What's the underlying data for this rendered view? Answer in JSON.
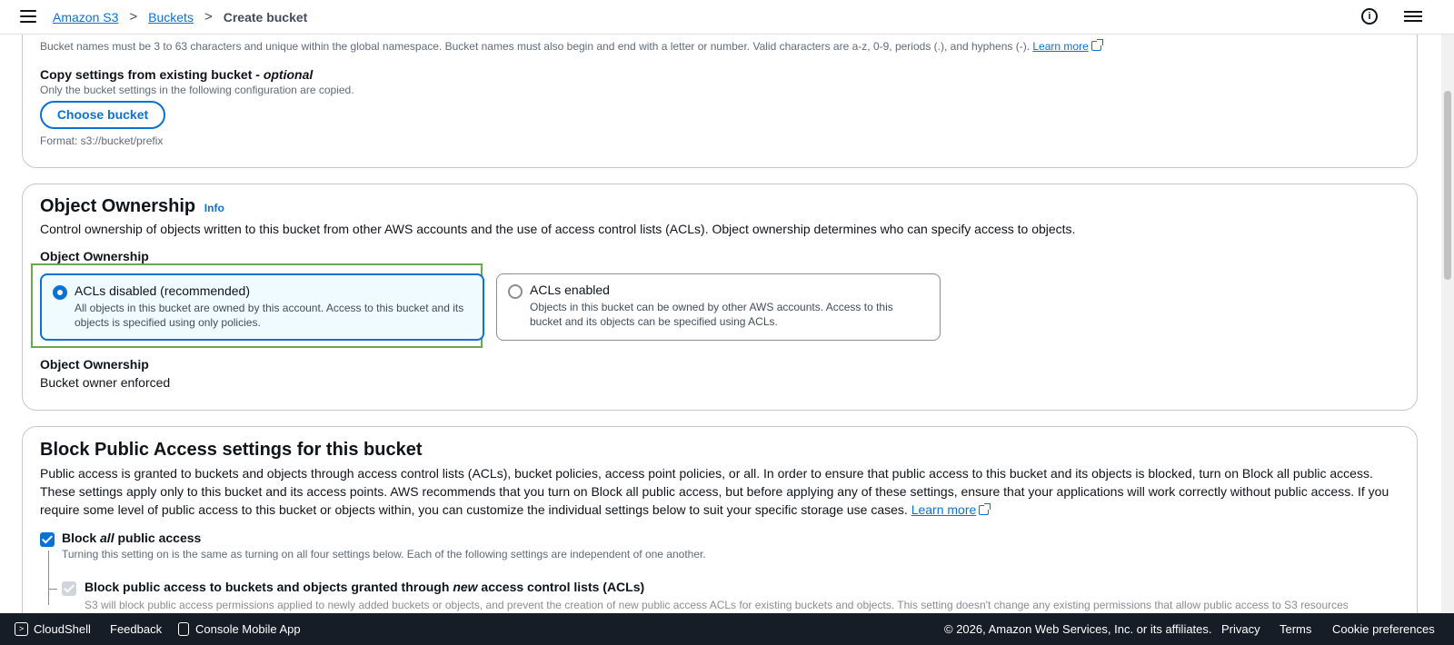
{
  "breadcrumb": {
    "items": [
      "Amazon S3",
      "Buckets"
    ],
    "current": "Create bucket",
    "separator": ">"
  },
  "topbar": {
    "info_icon": "info-icon",
    "tools_icon": "settings-panel-icon"
  },
  "bucket_name": {
    "help": "Bucket names must be 3 to 63 characters and unique within the global namespace. Bucket names must also begin and end with a letter or number. Valid characters are a-z, 0-9, periods (.), and hyphens (-).",
    "learn_more": "Learn more"
  },
  "copy_settings": {
    "title": "Copy settings from existing bucket - ",
    "title_optional": "optional",
    "description": "Only the bucket settings in the following configuration are copied.",
    "button": "Choose bucket",
    "format": "Format: s3://bucket/prefix"
  },
  "object_ownership": {
    "heading": "Object Ownership",
    "info": "Info",
    "description": "Control ownership of objects written to this bucket from other AWS accounts and the use of access control lists (ACLs). Object ownership determines who can specify access to objects.",
    "field_label": "Object Ownership",
    "options": [
      {
        "label": "ACLs disabled (recommended)",
        "description": "All objects in this bucket are owned by this account. Access to this bucket and its objects is specified using only policies.",
        "selected": true
      },
      {
        "label": "ACLs enabled",
        "description": "Objects in this bucket can be owned by other AWS accounts. Access to this bucket and its objects can be specified using ACLs.",
        "selected": false
      }
    ],
    "result_label": "Object Ownership",
    "result_value": "Bucket owner enforced"
  },
  "block_public_access": {
    "heading": "Block Public Access settings for this bucket",
    "description": "Public access is granted to buckets and objects through access control lists (ACLs), bucket policies, access point policies, or all. In order to ensure that public access to this bucket and its objects is blocked, turn on Block all public access. These settings apply only to this bucket and its access points. AWS recommends that you turn on Block all public access, but before applying any of these settings, ensure that your applications will work correctly without public access. If you require some level of public access to this bucket or objects within, you can customize the individual settings below to suit your specific storage use cases.",
    "learn_more": "Learn more",
    "block_all": {
      "prefix": "Block ",
      "emphasis": "all",
      "suffix": " public access",
      "description": "Turning this setting on is the same as turning on all four settings below. Each of the following settings are independent of one another.",
      "checked": true
    },
    "sub_1": {
      "prefix": "Block public access to buckets and objects granted through ",
      "emphasis": "new",
      "suffix": " access control lists (ACLs)",
      "description": "S3 will block public access permissions applied to newly added buckets or objects, and prevent the creation of new public access ACLs for existing buckets and objects. This setting doesn't change any existing permissions that allow public access to S3 resources",
      "checked": true
    }
  },
  "footer": {
    "cloudshell": "CloudShell",
    "feedback": "Feedback",
    "mobile_app": "Console Mobile App",
    "copyright": "© 2026, Amazon Web Services, Inc. or its affiliates.",
    "privacy": "Privacy",
    "terms": "Terms",
    "cookies": "Cookie preferences"
  }
}
